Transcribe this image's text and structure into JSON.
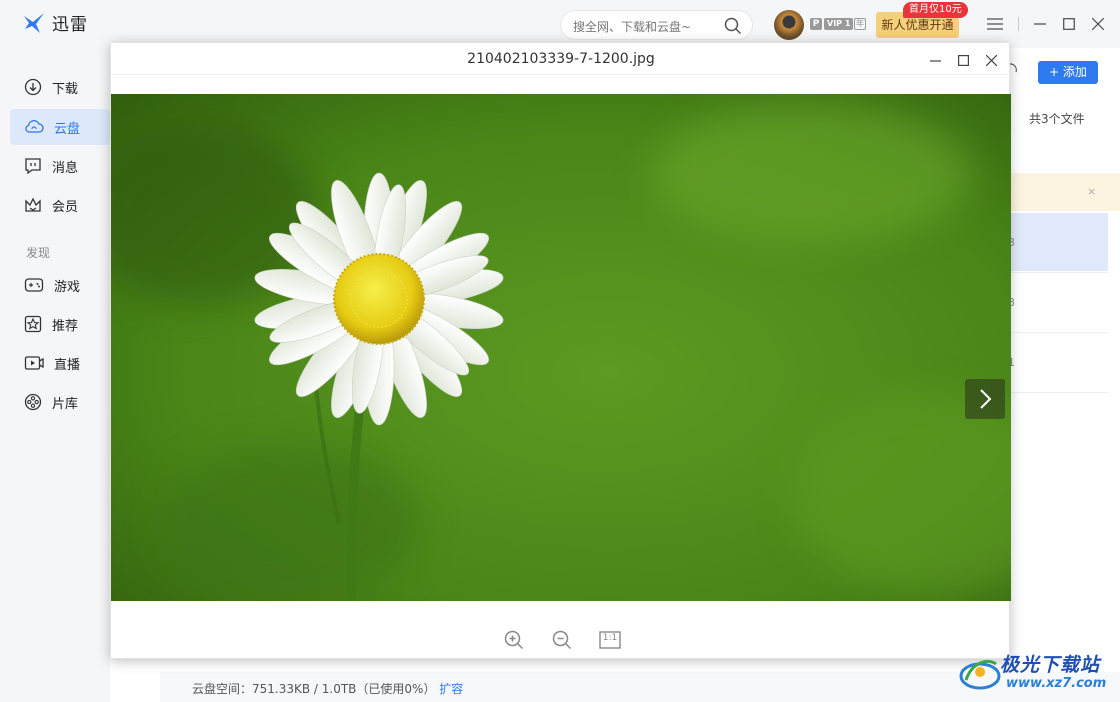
{
  "app": {
    "name": "迅雷"
  },
  "search": {
    "placeholder": "搜全网、下载和云盘~"
  },
  "vip": {
    "p": "P",
    "vip_label": "VIP 1",
    "year": "年"
  },
  "promo": {
    "button": "新人优惠开通",
    "tag": "首月仅10元"
  },
  "sidebar": {
    "items": [
      {
        "label": "下载",
        "icon": "download-icon"
      },
      {
        "label": "云盘",
        "icon": "cloud-icon",
        "active": true
      },
      {
        "label": "消息",
        "icon": "message-icon"
      },
      {
        "label": "会员",
        "icon": "crown-icon"
      }
    ],
    "section_discover": "发现",
    "discover_items": [
      {
        "label": "游戏",
        "icon": "gamepad-icon"
      },
      {
        "label": "推荐",
        "icon": "star-icon"
      },
      {
        "label": "直播",
        "icon": "live-icon"
      },
      {
        "label": "片库",
        "icon": "film-reel-icon"
      }
    ]
  },
  "main": {
    "add_button": "添加",
    "file_count": "共3个文件",
    "notice_close": "×",
    "row_fragments": [
      "3",
      "3",
      "1"
    ]
  },
  "viewer": {
    "title": "210402103339-7-1200.jpg",
    "ratio_label": "1:1"
  },
  "status": {
    "storage_text": "云盘空间：751.33KB / 1.0TB（已使用0%）",
    "expand_link": "扩容"
  },
  "watermark": {
    "text": "极光下载站",
    "url": "www.xz7.com"
  },
  "colors": {
    "accent": "#2f7aef",
    "sidebar_active_bg": "#dde8fb",
    "promo_bg": "#f6cf7c",
    "promo_tag": "#e8343a"
  }
}
